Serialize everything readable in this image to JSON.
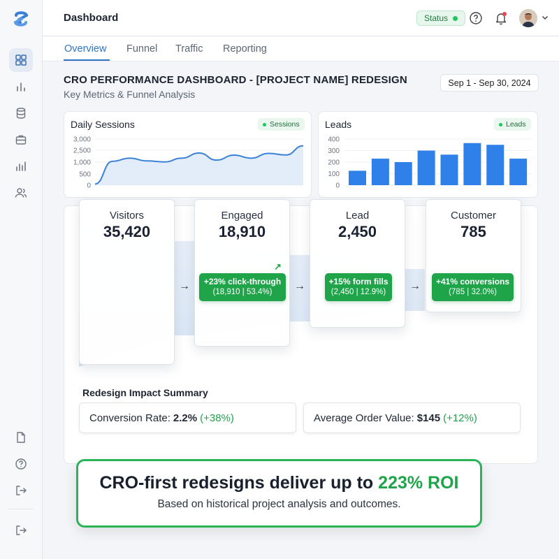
{
  "header": {
    "title": "Dashboard",
    "status_label": "Status"
  },
  "tabs": [
    {
      "label": "Overview"
    },
    {
      "label": "Funnel"
    },
    {
      "label": "Traffic"
    },
    {
      "label": "Reporting"
    }
  ],
  "dashboard": {
    "title": "CRO PERFORMANCE DASHBOARD - [PROJECT NAME] REDESIGN",
    "subtitle": "Key Metrics & Funnel Analysis",
    "date_range": "Sep 1 - Sep 30, 2024"
  },
  "chart_data": [
    {
      "type": "area",
      "title": "Daily Sessions",
      "legend": [
        "Sessions"
      ],
      "y_ticks": [
        "3,000",
        "2,500",
        "1,000",
        "500",
        "0"
      ],
      "x": [
        0,
        1,
        2,
        3,
        4,
        5,
        6,
        7,
        8,
        9,
        10,
        11,
        12
      ],
      "values": [
        50,
        1100,
        1500,
        1150,
        1020,
        1500,
        2150,
        1250,
        1880,
        1500,
        2100,
        1900,
        2700
      ],
      "ylim": [
        0,
        3000
      ],
      "grid": true,
      "color": "#3b82d6"
    },
    {
      "type": "bar",
      "title": "Leads",
      "legend": [
        "Leads"
      ],
      "y_ticks": [
        "400",
        "300",
        "200",
        "100",
        "0"
      ],
      "values": [
        125,
        230,
        200,
        300,
        265,
        365,
        350,
        230
      ],
      "ylim": [
        0,
        400
      ],
      "grid": true,
      "color": "#2f80e8"
    }
  ],
  "funnel": {
    "stages": [
      {
        "name": "Visitors",
        "value": "35,420"
      },
      {
        "name": "Engaged",
        "value": "18,910"
      },
      {
        "name": "Lead",
        "value": "2,450"
      },
      {
        "name": "Customer",
        "value": "785"
      }
    ],
    "conversions": [
      {
        "line1": "+23% click-through",
        "line2": "(18,910 | 53.4%)"
      },
      {
        "line1": "+15% form fills",
        "line2": "(2,450 | 12.9%)"
      },
      {
        "line1": "+41% conversions",
        "line2": "(785 | 32.0%)"
      }
    ],
    "arrow_glyph": "→",
    "trend_glyph": "↗"
  },
  "impact": {
    "title": "Redesign Impact Summary",
    "items": [
      {
        "label": "Conversion Rate:",
        "value": "2.2%",
        "delta": "(+38%)"
      },
      {
        "label": "Average Order Value:",
        "value": "$145",
        "delta": "(+12%)"
      }
    ]
  },
  "banner": {
    "headline_prefix": "CRO-first redesigns deliver up to",
    "headline_highlight": "223% ROI",
    "subtext": "Based on historical project analysis and outcomes."
  },
  "icons": {
    "sidebar": [
      "dashboard-icon",
      "bar-chart-icon",
      "database-icon",
      "briefcase-icon",
      "analytics-icon",
      "users-icon",
      "document-icon",
      "help-icon",
      "logout-icon",
      "exit-icon"
    ],
    "top": [
      "help-icon",
      "bell-icon",
      "avatar",
      "chevron-down-icon"
    ]
  },
  "colors": {
    "accent": "#2f74c6",
    "success": "#1fa44a",
    "chart_blue": "#3b82d6"
  }
}
